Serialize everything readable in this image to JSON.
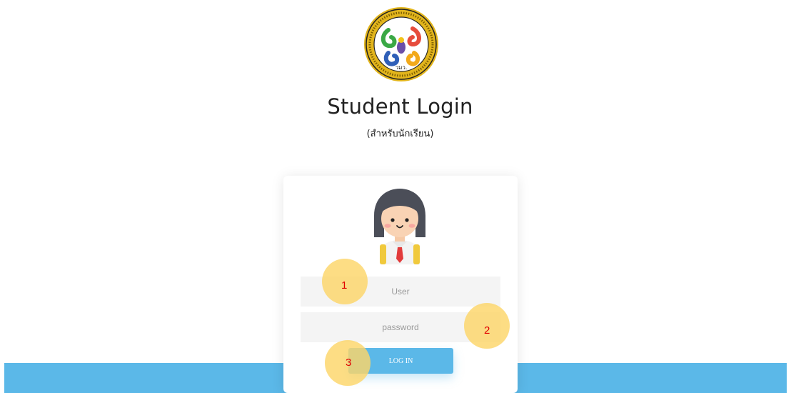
{
  "header": {
    "logo_icon": "school-emblem-icon",
    "logo_text": "วมว.",
    "title": "Student Login",
    "subtitle": "(สำหรับนักเรียน)"
  },
  "login_card": {
    "avatar_icon": "student-avatar-icon",
    "user_field": {
      "placeholder": "User",
      "value": ""
    },
    "password_field": {
      "placeholder": "password",
      "value": ""
    },
    "login_label": "LOG IN"
  },
  "markers": [
    {
      "label": "1"
    },
    {
      "label": "2"
    },
    {
      "label": "3"
    }
  ],
  "colors": {
    "accent": "#5bb8e8",
    "field_bg": "#f4f4f4",
    "marker_fill": "#fdd569",
    "marker_text": "#e00000",
    "logo_ring": "#e2b51c"
  }
}
